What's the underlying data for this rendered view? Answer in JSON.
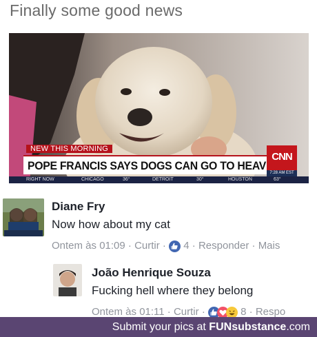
{
  "post": {
    "caption": "Finally some good news"
  },
  "news": {
    "ticker_tag": "NEW THIS MORNING",
    "headline": "POPE FRANCIS SAYS DOGS CAN GO TO HEAVEN",
    "network_logo": "CNN",
    "time": "7:28 AM EST",
    "ticker": [
      "RIGHT NOW",
      "CHICAGO",
      "36°",
      "DETROIT",
      "30°",
      "HOUSTON",
      "63°"
    ]
  },
  "comments": [
    {
      "author": "Diane Fry",
      "text": "Now how about my cat",
      "time": "Ontem às 01:09",
      "like_label": "Curtir",
      "reaction_count": "4",
      "reply_label": "Responder",
      "more_label": "Mais"
    },
    {
      "author": "João Henrique Souza",
      "text": "Fucking hell where they belong",
      "time": "Ontem às 01:11",
      "like_label": "Curtir",
      "reaction_count": "8",
      "reply_label": "Respo"
    }
  ],
  "footer": {
    "text": "Submit your pics at ",
    "brand_a": "FUN",
    "brand_b": "substance",
    "brand_c": ".com"
  },
  "colors": {
    "footer_bg": "#5a4572",
    "facebook_blue": "#4267b2",
    "cnn_red": "#c4161c"
  }
}
